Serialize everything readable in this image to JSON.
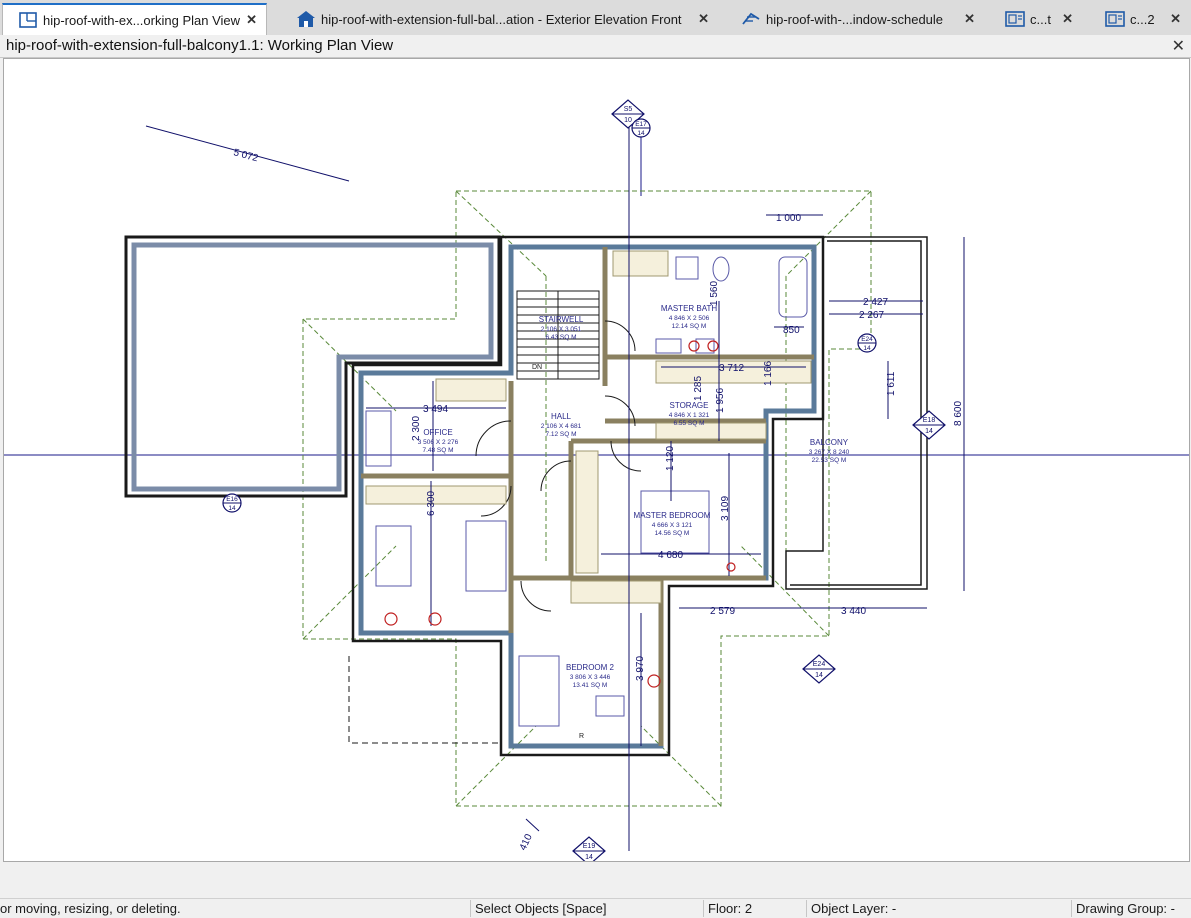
{
  "tabs": [
    {
      "label": "hip-roof-with-ex...orking Plan View",
      "active": true,
      "icon": "plan-view-icon"
    },
    {
      "label": "hip-roof-with-extension-full-bal...ation - Exterior Elevation Front",
      "active": false,
      "icon": "elevation-house-icon"
    },
    {
      "label": "hip-roof-with-...indow-schedule",
      "active": false,
      "icon": "schedule-icon"
    },
    {
      "label": "c...t",
      "active": false,
      "icon": "layout-sheet-icon"
    },
    {
      "label": "c...2",
      "active": false,
      "icon": "layout-sheet-icon"
    }
  ],
  "view": {
    "title": "hip-roof-with-extension-full-balcony1.1:  Working Plan View"
  },
  "rooms": [
    {
      "name": "STAIRWELL",
      "size": "2 106 X 3 051",
      "area": "6.43 SQ M"
    },
    {
      "name": "MASTER BATH",
      "size": "4 846 X 2 506",
      "area": "12.14 SQ M"
    },
    {
      "name": "STORAGE",
      "size": "4 846 X 1 321",
      "area": "6.55 SQ M"
    },
    {
      "name": "HALL",
      "size": "2 106 X 4 681",
      "area": "7.12 SQ M"
    },
    {
      "name": "OFFICE",
      "size": "3 506 X 2 276",
      "area": "7.48 SQ M"
    },
    {
      "name": "BALCONY",
      "size": "3 267 X 8 240",
      "area": "22.53 SQ M"
    },
    {
      "name": "MASTER BEDROOM",
      "size": "4 666 X 3 121",
      "area": "14.56 SQ M"
    },
    {
      "name": "BEDROOM 2",
      "size": "3 806 X 3 446",
      "area": "13.41 SQ M"
    }
  ],
  "dimensions": [
    "5 072",
    "1 000",
    "2 427",
    "2 267",
    "850",
    "8 600",
    "1 611",
    "3 712",
    "1 166",
    "3 494",
    "2 300",
    "1 956",
    "1 120",
    "6 300",
    "3 109",
    "4 680",
    "2 579",
    "3 440",
    "3 970",
    "410",
    "1 285",
    "1 560"
  ],
  "markers": [
    {
      "top": "S5",
      "bottom": "10"
    },
    {
      "top": "E17",
      "bottom": "14"
    },
    {
      "top": "E24",
      "bottom": "14"
    },
    {
      "top": "E18",
      "bottom": "14"
    },
    {
      "top": "E16",
      "bottom": "14"
    },
    {
      "top": "E24",
      "bottom": "14"
    },
    {
      "top": "E19",
      "bottom": "14"
    }
  ],
  "labels": {
    "down": "DN",
    "range": "R"
  },
  "status": {
    "hint": "or moving, resizing, or deleting.",
    "mode": "Select Objects [Space]",
    "floor": "Floor: 2",
    "layer": "Object Layer: -",
    "group": "Drawing Group: -"
  },
  "colors": {
    "wall": "#2a2a5a",
    "roof": "#5a8a3a",
    "dim": "#10106a",
    "room": "#6a6ab0",
    "accent": "#1f6fc7"
  }
}
